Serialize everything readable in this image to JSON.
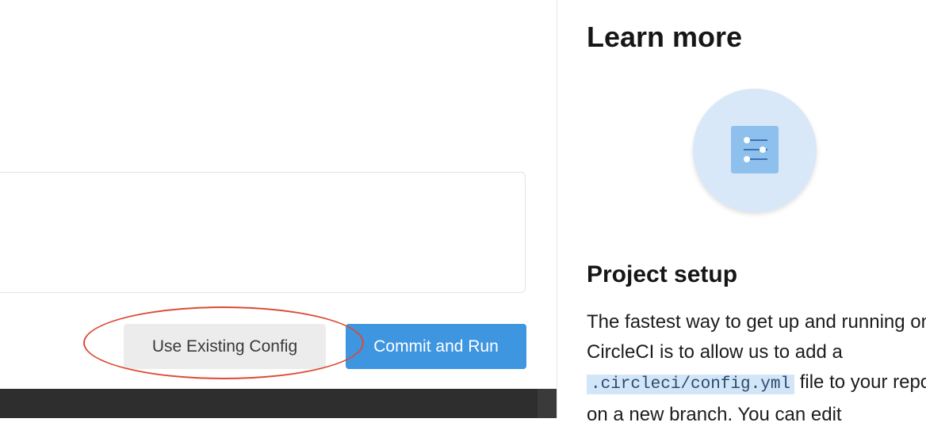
{
  "actions": {
    "use_existing_config_label": "Use Existing Config",
    "commit_and_run_label": "Commit and Run"
  },
  "learn_more": {
    "title": "Learn more",
    "illustration_icon": "config-sliders-icon",
    "section_title": "Project setup",
    "text_part1": "The fastest way to get up and running on CircleCI is to allow us to add a ",
    "code": ".circleci/config.yml",
    "text_part2": " file to your repo on a new branch. You can edit"
  },
  "colors": {
    "primary_button": "#3e95e0",
    "secondary_button": "#ececec",
    "annotation": "#dc4a34",
    "illustration_bg": "#d8e8f8",
    "code_bg": "#d2e6f8"
  }
}
